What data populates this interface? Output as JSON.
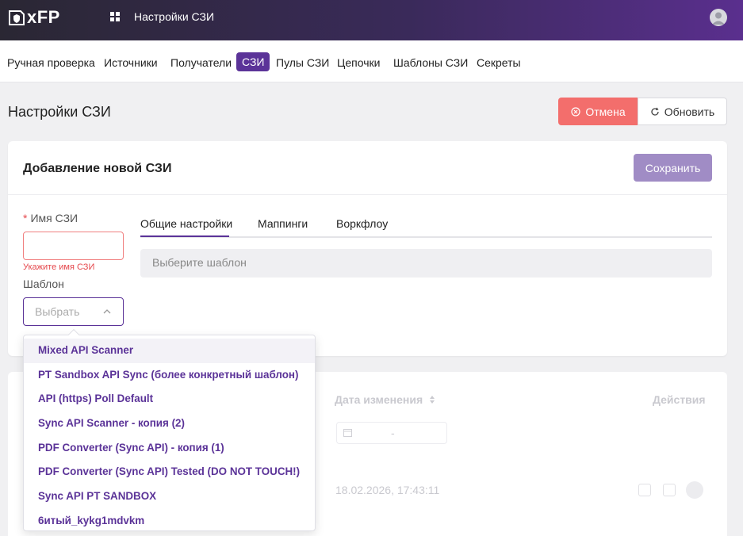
{
  "header": {
    "logo_text": "xFP",
    "app_title": "Настройки СЗИ",
    "icons": [
      "shield-logo-icon",
      "apps-grid-icon",
      "user-avatar-icon"
    ]
  },
  "nav": {
    "items": [
      {
        "label": "Ручная проверка"
      },
      {
        "label": "Источники"
      },
      {
        "label": "Получатели"
      },
      {
        "label": "СЗИ"
      },
      {
        "label": "Пулы СЗИ"
      },
      {
        "label": "Цепочки"
      },
      {
        "label": "Шаблоны СЗИ"
      },
      {
        "label": "Секреты"
      }
    ],
    "active": "СЗИ"
  },
  "page": {
    "title": "Настройки СЗИ",
    "cancel_label": "Отмена",
    "refresh_label": "Обновить"
  },
  "form": {
    "title": "Добавление новой СЗИ",
    "save_label": "Сохранить",
    "name_label": "Имя СЗИ",
    "name_value": "",
    "name_error": "Укажите имя СЗИ",
    "template_label": "Шаблон",
    "template_placeholder": "Выбрать",
    "tabs": [
      {
        "label": "Общие настройки"
      },
      {
        "label": "Маппинги"
      },
      {
        "label": "Воркфлоу"
      }
    ],
    "template_box_placeholder": "Выберите шаблон"
  },
  "table": {
    "col_date": "Дата изменения",
    "col_actions": "Действия",
    "date_separator": "-",
    "row_date": "18.02.2026, 17:43:11"
  },
  "dropdown": {
    "options": [
      "Mixed API Scanner",
      "PT Sandbox API Sync (более конкретный шаблон)",
      "API (https) Poll Default",
      "Sync API Scanner - копия (2)",
      "PDF Converter (Sync API) - копия (1)",
      "PDF Converter (Sync API) Tested (DO NOT TOUCH!)",
      "Sync API PT SANDBOX",
      "6итый_kykg1mdvkm"
    ]
  },
  "colors": {
    "accent": "#5b3398",
    "cancel": "#f36e6c",
    "save": "#a08cc5",
    "error": "#e5484d"
  }
}
